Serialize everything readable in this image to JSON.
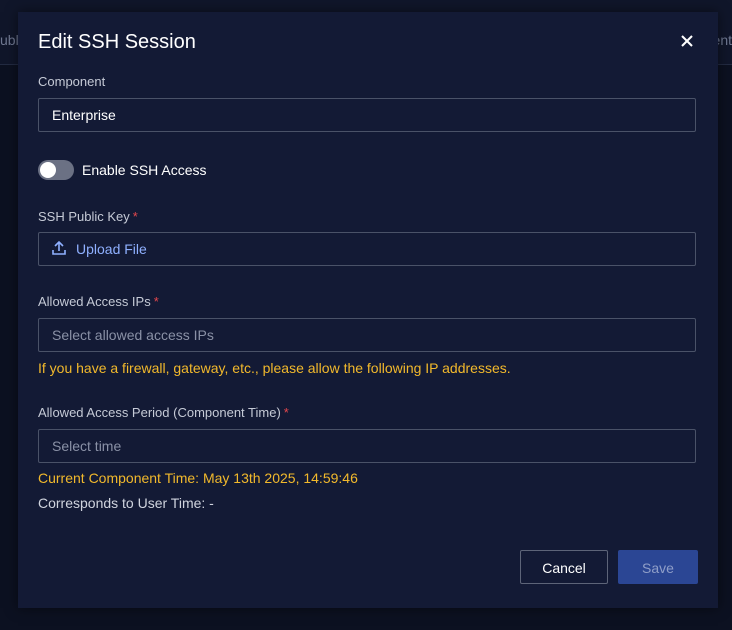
{
  "background": {
    "left_text": "ubli",
    "right_text": "ent"
  },
  "modal": {
    "title": "Edit SSH Session",
    "close_icon": "close-icon"
  },
  "component": {
    "label": "Component",
    "value": "Enterprise"
  },
  "ssh_toggle": {
    "label": "Enable SSH Access",
    "enabled": false
  },
  "public_key": {
    "label": "SSH Public Key",
    "required_mark": "*",
    "upload_label": "Upload File",
    "upload_icon": "upload-icon"
  },
  "allowed_ips": {
    "label": "Allowed Access IPs",
    "required_mark": "*",
    "placeholder": "Select allowed access IPs",
    "warning": "If you have a firewall, gateway, etc., please allow the following IP addresses."
  },
  "access_period": {
    "label": "Allowed Access Period (Component Time)",
    "required_mark": "*",
    "placeholder": "Select time",
    "component_time": "Current Component Time: May 13th 2025, 14:59:46",
    "user_time": "Corresponds to User Time: -"
  },
  "actions": {
    "cancel_label": "Cancel",
    "save_label": "Save"
  },
  "colors": {
    "modal_bg": "#131a35",
    "accent_link": "#8fb0ff",
    "warning": "#f2b92c",
    "required": "#e5484d",
    "primary_button": "#2b4694"
  }
}
